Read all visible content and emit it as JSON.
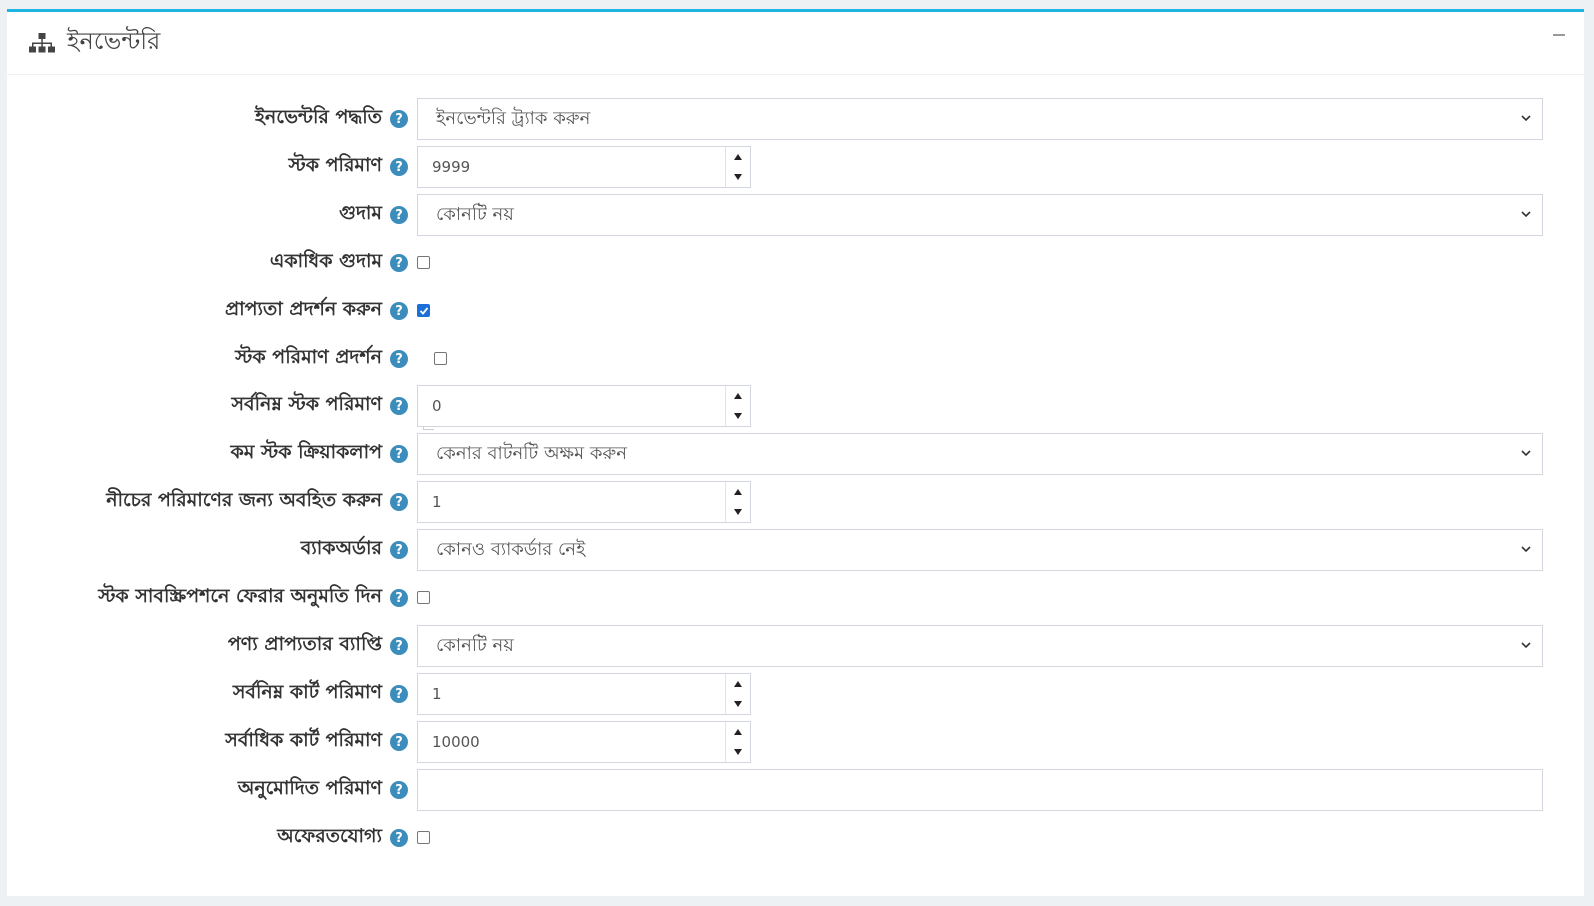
{
  "panel": {
    "title": "ইনভেন্টরি",
    "collapse_icon": "minus-icon",
    "header_icon": "sitemap-icon"
  },
  "fields": {
    "inventory_method": {
      "label": "ইনভেন্টরি পদ্ধতি",
      "value": "ইনভেন্টরি ট্র্যাক করুন"
    },
    "stock_quantity": {
      "label": "স্টক পরিমাণ",
      "value": "9999"
    },
    "warehouse": {
      "label": "গুদাম",
      "value": "কোনটি নয়"
    },
    "multiple_warehouses": {
      "label": "একাধিক গুদাম",
      "checked": false
    },
    "display_availability": {
      "label": "প্রাপ্যতা প্রদর্শন করুন",
      "checked": true
    },
    "display_stock_quantity": {
      "label": "স্টক পরিমাণ প্রদর্শন",
      "checked": false
    },
    "min_stock_quantity": {
      "label": "সর্বনিম্ন স্টক পরিমাণ",
      "value": "0"
    },
    "low_stock_activity": {
      "label": "কম স্টক ক্রিয়াকলাপ",
      "value": "কেনার বাটনটি অক্ষম করুন"
    },
    "notify_below_quantity": {
      "label": "নীচের পরিমাণের জন্য অবহিত করুন",
      "value": "1"
    },
    "backorders": {
      "label": "ব্যাকঅর্ডার",
      "value": "কোনও ব্যাকর্ডার নেই"
    },
    "allow_back_in_stock_subscriptions": {
      "label": "স্টক সাবস্ক্রিপশনে ফেরার অনুমতি দিন",
      "checked": false
    },
    "product_availability_range": {
      "label": "পণ্য প্রাপ্যতার ব্যাপ্তি",
      "value": "কোনটি নয়"
    },
    "min_cart_quantity": {
      "label": "সর্বনিম্ন কার্ট পরিমাণ",
      "value": "1"
    },
    "max_cart_quantity": {
      "label": "সর্বাধিক কার্ট পরিমাণ",
      "value": "10000"
    },
    "allowed_quantities": {
      "label": "অনুমোদিত পরিমাণ",
      "value": ""
    },
    "not_returnable": {
      "label": "অফেরতযোগ্য",
      "checked": false
    }
  },
  "help_glyph": "?",
  "colors": {
    "accent": "#1fb5e3",
    "help_icon": "#3c8dbc",
    "checkbox_checked": "#1a6fd8"
  }
}
